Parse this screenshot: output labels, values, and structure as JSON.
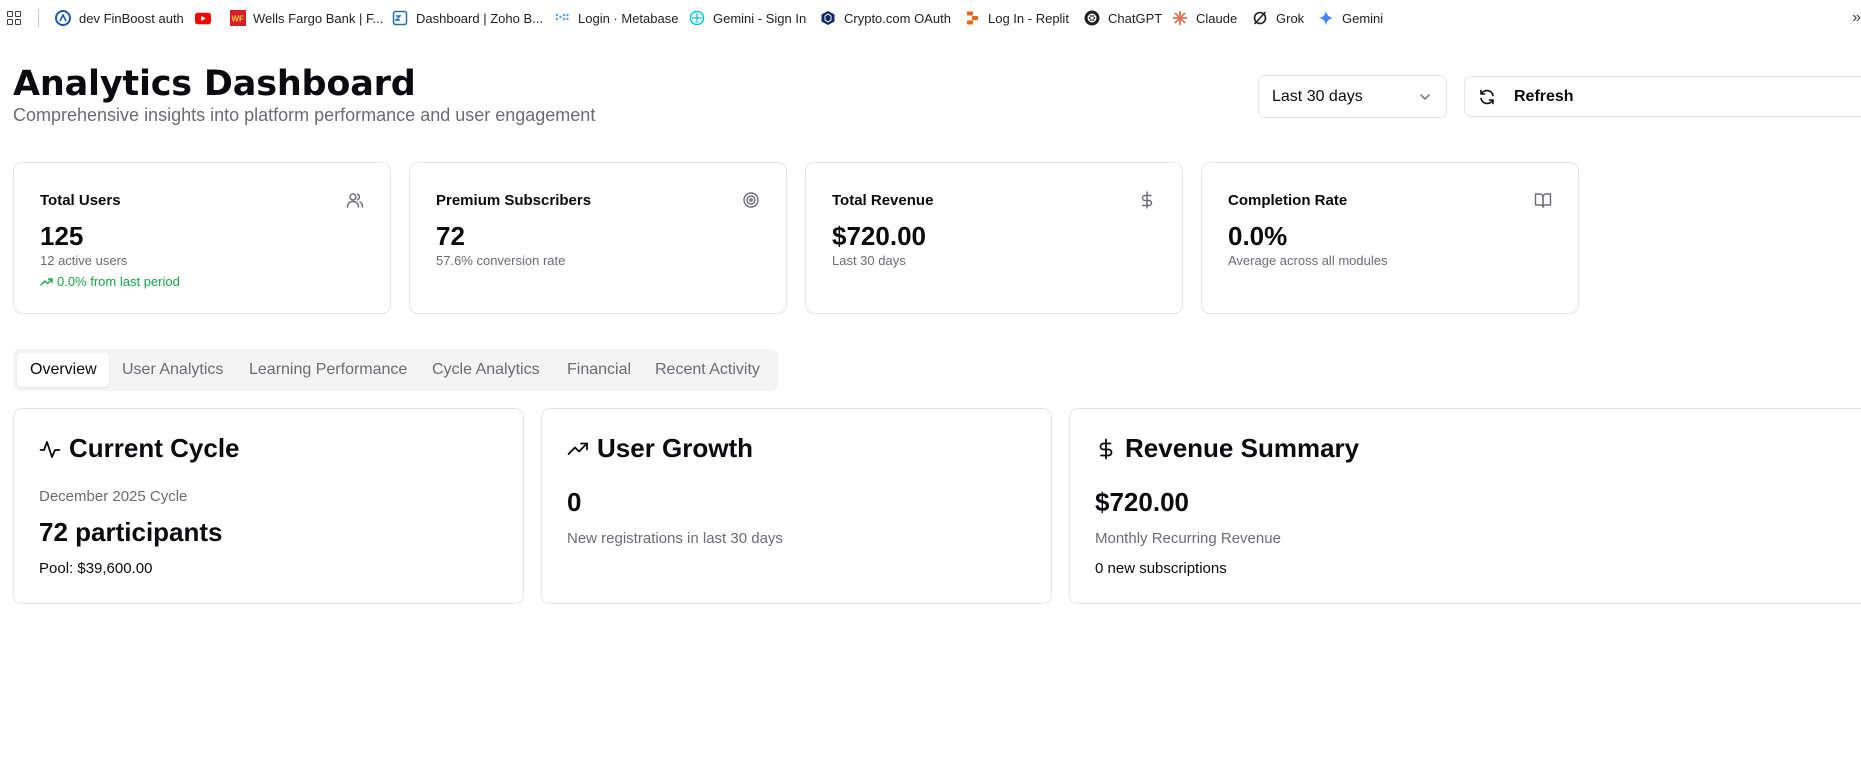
{
  "bookmarks": [
    {
      "label": "dev FinBoost auth",
      "icon": "finboost-icon"
    },
    {
      "label": "",
      "icon": "youtube-icon"
    },
    {
      "label": "Wells Fargo Bank | F...",
      "icon": "wells-fargo-icon"
    },
    {
      "label": "Dashboard | Zoho B...",
      "icon": "zoho-icon"
    },
    {
      "label": "Login · Metabase",
      "icon": "metabase-icon"
    },
    {
      "label": "Gemini - Sign In",
      "icon": "gemini-signin-icon"
    },
    {
      "label": "Crypto.com OAuth",
      "icon": "crypto-icon"
    },
    {
      "label": "Log In - Replit",
      "icon": "replit-icon"
    },
    {
      "label": "ChatGPT",
      "icon": "chatgpt-icon"
    },
    {
      "label": "Claude",
      "icon": "claude-icon"
    },
    {
      "label": "Grok",
      "icon": "grok-icon"
    },
    {
      "label": "Gemini",
      "icon": "gemini-icon"
    }
  ],
  "header": {
    "title": "Analytics Dashboard",
    "subtitle": "Comprehensive insights into platform performance and user engagement",
    "range_select": "Last 30 days",
    "refresh_label": "Refresh"
  },
  "stats": [
    {
      "label": "Total Users",
      "value": "125",
      "sub": "12 active users",
      "trend": "0.0% from last period",
      "icon": "users-icon"
    },
    {
      "label": "Premium Subscribers",
      "value": "72",
      "sub": "57.6% conversion rate",
      "icon": "target-icon"
    },
    {
      "label": "Total Revenue",
      "value": "$720.00",
      "sub": "Last 30 days",
      "icon": "dollar-icon"
    },
    {
      "label": "Completion Rate",
      "value": "0.0%",
      "sub": "Average across all modules",
      "icon": "book-icon"
    }
  ],
  "tabs": [
    "Overview",
    "User Analytics",
    "Learning Performance",
    "Cycle Analytics",
    "Financial",
    "Recent Activity"
  ],
  "active_tab": "Overview",
  "cards": {
    "cycle": {
      "title": "Current Cycle",
      "name": "December 2025 Cycle",
      "participants": "72 participants",
      "pool": "Pool: $39,600.00"
    },
    "growth": {
      "title": "User Growth",
      "value": "0",
      "desc": "New registrations in last 30 days"
    },
    "revenue": {
      "title": "Revenue Summary",
      "value": "$720.00",
      "desc": "Monthly Recurring Revenue",
      "extra": "0 new subscriptions"
    }
  },
  "colors": {
    "accent_green": "#16a34a",
    "muted_text": "#6b6b73",
    "border": "#e4e4e7"
  }
}
